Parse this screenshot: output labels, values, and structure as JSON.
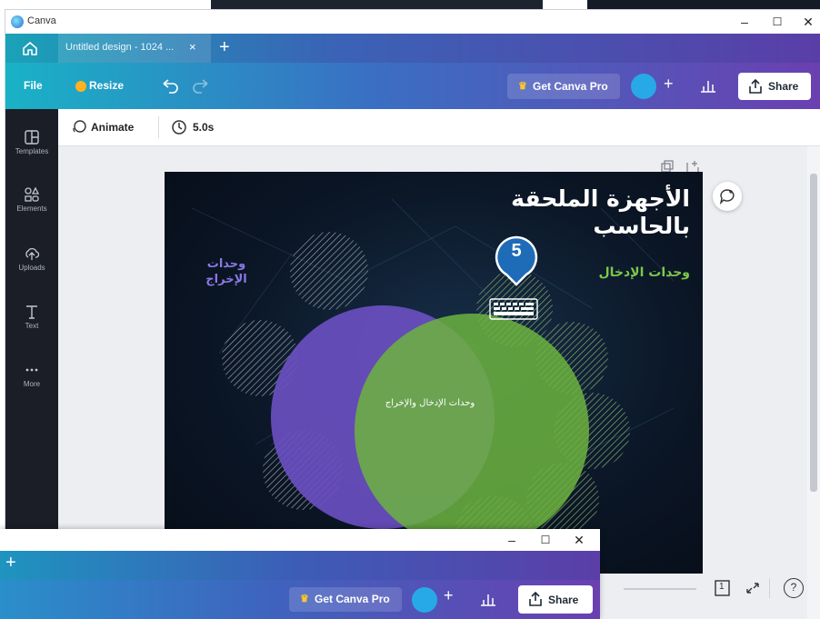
{
  "app": {
    "name": "Canva"
  },
  "window_controls": {
    "minimize": "–",
    "maximize": "☐",
    "close": "✕"
  },
  "tab": {
    "label": "Untitled design - 1024 ...",
    "close": "×",
    "new_tab": "+"
  },
  "toolbar": {
    "file_label": "File",
    "resize_label": "Resize",
    "get_pro_label": "Get Canva Pro",
    "plus_label": "+",
    "share_label": "Share"
  },
  "sidebar": {
    "items": [
      {
        "label": "Templates",
        "icon": "templates-icon"
      },
      {
        "label": "Elements",
        "icon": "elements-icon"
      },
      {
        "label": "Uploads",
        "icon": "uploads-icon"
      },
      {
        "label": "Text",
        "icon": "text-icon"
      },
      {
        "label": "More",
        "icon": "more-icon"
      }
    ]
  },
  "subbar": {
    "animate_label": "Animate",
    "duration_label": "5.0s"
  },
  "slide": {
    "title_line1": "الأجهزة الملحقة",
    "title_line2": "بالحاسب",
    "output_label_line1": "وحدات",
    "output_label_line2": "الإخراج",
    "input_label": "وحدات الإدخال",
    "overlap_label": "وحدات الإدخال والإخراج",
    "colors": {
      "output_circle": "#6a4fc0",
      "input_circle": "#6cb33f",
      "background": "#0b1626"
    }
  },
  "callout": {
    "number": "5",
    "color": "#1e6bb8"
  },
  "bottom_controls": {
    "page_number": "1",
    "help": "?"
  },
  "window2": {
    "new_tab": "+",
    "get_pro_label": "Get Canva Pro",
    "plus_label": "+",
    "share_label": "Share"
  }
}
